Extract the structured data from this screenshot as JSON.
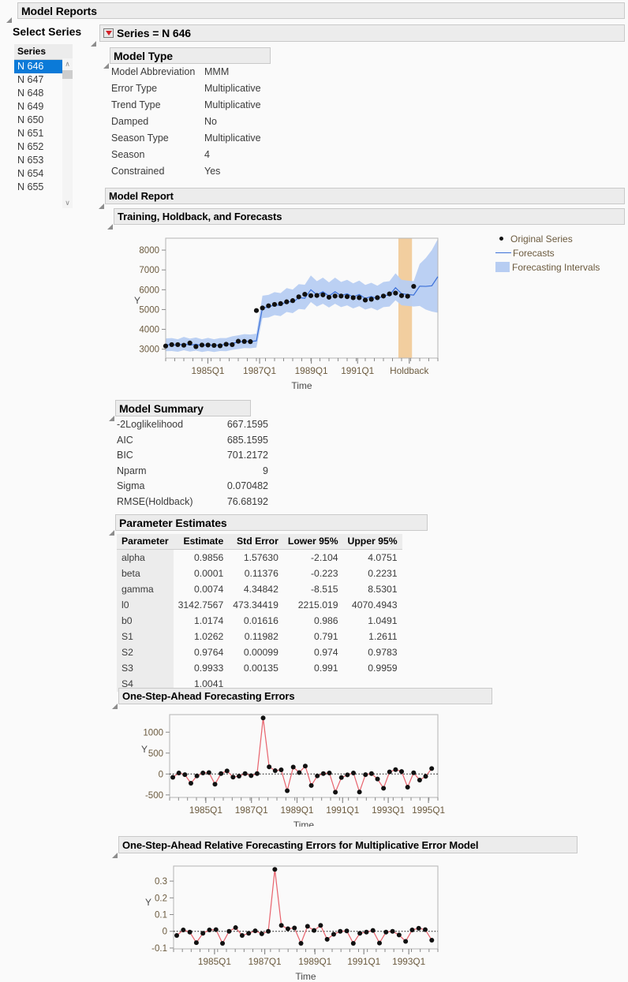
{
  "window": {
    "title": "Model Reports"
  },
  "select_series": {
    "label": "Select Series",
    "series_equals": "Series = N 646",
    "column_header": "Series",
    "items": [
      "N 646",
      "N 647",
      "N 648",
      "N 649",
      "N 650",
      "N 651",
      "N 652",
      "N 653",
      "N 654",
      "N 655"
    ],
    "selected": "N 646",
    "scroll_up": "∧",
    "scroll_down": "∨"
  },
  "model_type": {
    "title": "Model Type",
    "rows": [
      {
        "key": "Model Abbreviation",
        "value": "MMM"
      },
      {
        "key": "Error Type",
        "value": "Multiplicative"
      },
      {
        "key": "Trend Type",
        "value": "Multiplicative"
      },
      {
        "key": "Damped",
        "value": "No"
      },
      {
        "key": "Season Type",
        "value": "Multiplicative"
      },
      {
        "key": "Season",
        "value": "4"
      },
      {
        "key": "Constrained",
        "value": "Yes"
      }
    ]
  },
  "model_report": {
    "title": "Model Report"
  },
  "model_summary": {
    "title": "Model Summary",
    "rows": [
      {
        "key": "-2Loglikelihood",
        "value": "667.1595"
      },
      {
        "key": "AIC",
        "value": "685.1595"
      },
      {
        "key": "BIC",
        "value": "701.2172"
      },
      {
        "key": "Nparm",
        "value": "9"
      },
      {
        "key": "Sigma",
        "value": "0.070482"
      },
      {
        "key": "RMSE(Holdback)",
        "value": "76.68192"
      }
    ]
  },
  "parameter_estimates": {
    "title": "Parameter Estimates",
    "columns": [
      "Parameter",
      "Estimate",
      "Std Error",
      "Lower 95%",
      "Upper 95%"
    ],
    "rows": [
      [
        "alpha",
        "0.9856",
        "1.57630",
        "-2.104",
        "4.0751"
      ],
      [
        "beta",
        "0.0001",
        "0.11376",
        "-0.223",
        "0.2231"
      ],
      [
        "gamma",
        "0.0074",
        "4.34842",
        "-8.515",
        "8.5301"
      ],
      [
        "l0",
        "3142.7567",
        "473.34419",
        "2215.019",
        "4070.4943"
      ],
      [
        "b0",
        "1.0174",
        "0.01616",
        "0.986",
        "1.0491"
      ],
      [
        "S1",
        "1.0262",
        "0.11982",
        "0.791",
        "1.2611"
      ],
      [
        "S2",
        "0.9764",
        "0.00099",
        "0.974",
        "0.9783"
      ],
      [
        "S3",
        "0.9933",
        "0.00135",
        "0.991",
        "0.9959"
      ],
      [
        "S4",
        "1.0041",
        "",
        "",
        ""
      ]
    ]
  },
  "colors": {
    "original_series": "#111111",
    "forecast_line": "#3a6fd8",
    "forecast_band": "#b7cdf2",
    "holdback_band": "#f2ce9f",
    "error_line": "#e8626c",
    "selection_blue": "#0b7ad8",
    "header_gray": "#ececec",
    "axis_label": "#6b5a3e"
  },
  "chart_data": [
    {
      "id": "training-holdback-forecasts",
      "type": "line",
      "title": "Training, Holdback, and Forecasts",
      "xlabel": "Time",
      "ylabel": "Y",
      "ylim": [
        2550,
        8600
      ],
      "yticks": [
        3000,
        4000,
        5000,
        6000,
        7000,
        8000
      ],
      "xtick_labels": [
        "1985Q1",
        "1987Q1",
        "1989Q1",
        "1991Q1",
        "Holdback"
      ],
      "xtick_positions": [
        0.155,
        0.345,
        0.535,
        0.705,
        0.895
      ],
      "grid": false,
      "legend": [
        "Original Series",
        "Forecasts",
        "Forecasting Intervals"
      ],
      "legend_position": "right",
      "holdback_band_x": [
        0.855,
        0.905
      ],
      "series": [
        {
          "name": "Original Series",
          "marker": "dot",
          "values": [
            3160,
            3230,
            3230,
            3200,
            3310,
            3130,
            3210,
            3210,
            3190,
            3170,
            3250,
            3230,
            3400,
            3390,
            3380,
            4950,
            5080,
            5190,
            5260,
            5300,
            5390,
            5450,
            5640,
            5770,
            5700,
            5710,
            5740,
            5620,
            5680,
            5680,
            5650,
            5600,
            5600,
            5480,
            5520,
            5600,
            5680,
            5790,
            5830,
            5700,
            5670,
            6170
          ]
        },
        {
          "name": "Forecasts",
          "marker": "line",
          "values": [
            3220,
            3230,
            3180,
            3280,
            3200,
            3250,
            3170,
            3230,
            3170,
            3230,
            3220,
            3300,
            3350,
            3400,
            3390,
            3420,
            5090,
            5120,
            5250,
            5200,
            5430,
            5360,
            5600,
            5570,
            6000,
            5740,
            5900,
            5680,
            5900,
            5700,
            5800,
            5630,
            5760,
            5560,
            5660,
            5530,
            5700,
            5730,
            6100,
            5800,
            5760,
            5730,
            6180,
            6170,
            6200,
            6660
          ]
        },
        {
          "name": "Upper Interval",
          "marker": "band",
          "values": [
            3540,
            3560,
            3500,
            3620,
            3530,
            3590,
            3500,
            3570,
            3500,
            3560,
            3560,
            3650,
            3700,
            3760,
            3740,
            3780,
            5700,
            5740,
            5880,
            5830,
            6080,
            6010,
            6280,
            6250,
            6720,
            6430,
            6610,
            6370,
            6610,
            6390,
            6500,
            6320,
            6460,
            6240,
            6350,
            6200,
            6390,
            6430,
            6830,
            6500,
            6460,
            6430,
            7300,
            7600,
            8000,
            8560
          ]
        },
        {
          "name": "Lower Interval",
          "marker": "band",
          "values": [
            2900,
            2910,
            2870,
            2950,
            2880,
            2930,
            2860,
            2910,
            2860,
            2910,
            2900,
            2970,
            3010,
            3060,
            3050,
            3080,
            4570,
            4600,
            4720,
            4670,
            4880,
            4820,
            5030,
            5000,
            5380,
            5150,
            5290,
            5100,
            5290,
            5120,
            5210,
            5060,
            5170,
            5000,
            5090,
            4960,
            5120,
            5150,
            5470,
            5210,
            5180,
            5150,
            5180,
            5000,
            4900,
            4840
          ]
        }
      ]
    },
    {
      "id": "one-step-ahead-forecasting-errors",
      "type": "line",
      "title": "One-Step-Ahead Forecasting Errors",
      "xlabel": "Time",
      "ylabel": "Y",
      "ylim": [
        -560,
        1420
      ],
      "yticks": [
        -500,
        0,
        500,
        1000
      ],
      "xtick_labels": [
        "1985Q1",
        "1987Q1",
        "1989Q1",
        "1991Q1",
        "1993Q1",
        "1995Q1"
      ],
      "xtick_positions": [
        0.135,
        0.305,
        0.475,
        0.645,
        0.815,
        0.965
      ],
      "zero_line": true,
      "values": [
        -80,
        25,
        -15,
        -220,
        -45,
        25,
        35,
        -245,
        10,
        75,
        -75,
        -50,
        10,
        -40,
        10,
        1340,
        170,
        80,
        100,
        -400,
        165,
        35,
        190,
        -275,
        -45,
        10,
        25,
        -435,
        -85,
        -20,
        25,
        -430,
        -15,
        10,
        -120,
        -340,
        50,
        105,
        60,
        -315,
        30,
        -145,
        -55,
        130
      ]
    },
    {
      "id": "one-step-ahead-relative-forecasting-errors",
      "type": "line",
      "title": "One-Step-Ahead Relative Forecasting Errors for Multiplicative Error Model",
      "xlabel": "Time",
      "ylabel": "Y",
      "ylim": [
        -0.105,
        0.39
      ],
      "yticks": [
        -0.1,
        0,
        0.1,
        0.2,
        0.3
      ],
      "ytick_labels": [
        "-0.1",
        "0",
        "0.1",
        "0.2",
        "0.3"
      ],
      "xtick_labels": [
        "1985Q1",
        "1987Q1",
        "1989Q1",
        "1991Q1",
        "1993Q1"
      ],
      "xtick_positions": [
        0.155,
        0.345,
        0.535,
        0.72,
        0.89
      ],
      "zero_line": true,
      "values": [
        -0.025,
        0.008,
        -0.005,
        -0.068,
        -0.012,
        0.008,
        0.01,
        -0.072,
        0.0,
        0.022,
        -0.025,
        -0.012,
        0.003,
        -0.015,
        0.0,
        0.37,
        0.035,
        0.015,
        0.02,
        -0.072,
        0.03,
        0.005,
        0.035,
        -0.048,
        -0.018,
        0.0,
        0.002,
        -0.072,
        -0.012,
        -0.005,
        0.005,
        -0.07,
        -0.005,
        0.0,
        -0.022,
        -0.06,
        0.008,
        0.018,
        0.01,
        -0.053
      ]
    }
  ]
}
